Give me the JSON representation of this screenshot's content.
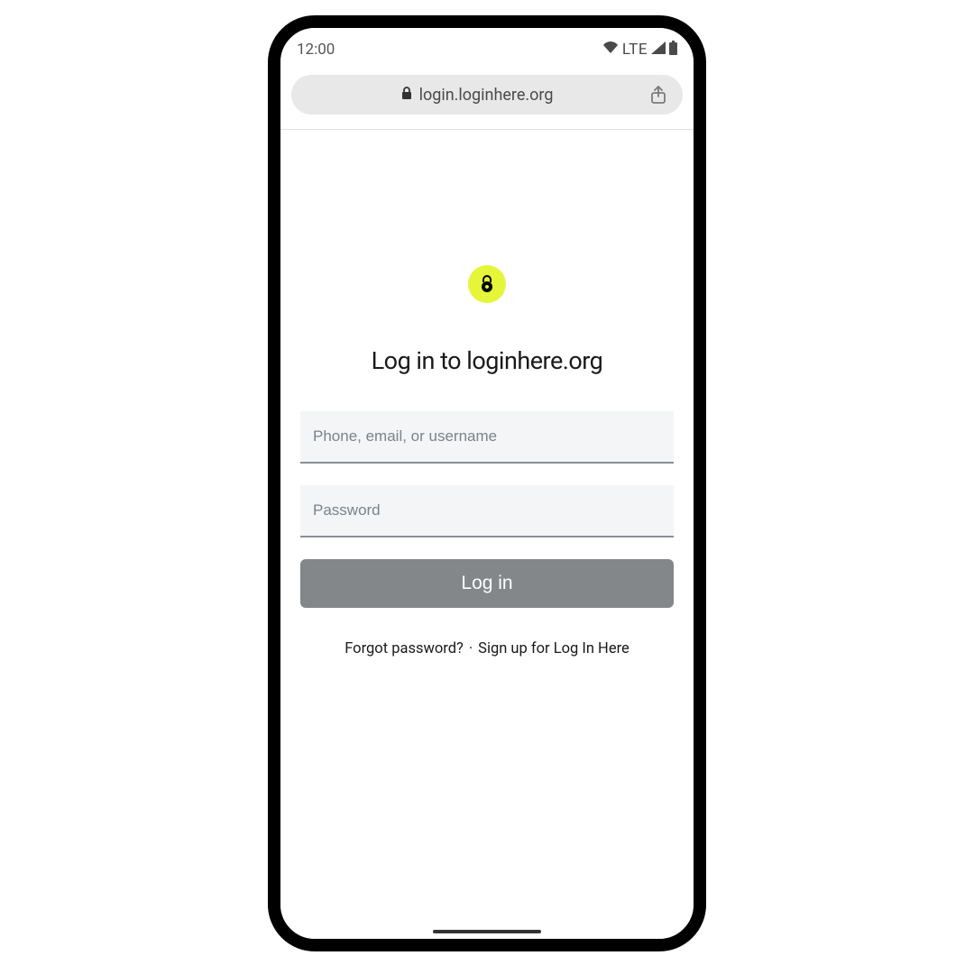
{
  "status_bar": {
    "time": "12:00",
    "network_type": "LTE"
  },
  "browser": {
    "url": "login.loginhere.org"
  },
  "login": {
    "title": "Log in to loginhere.org",
    "username_placeholder": "Phone, email, or username",
    "password_placeholder": "Password",
    "button_label": "Log in",
    "forgot_link": "Forgot password?",
    "signup_link": "Sign up for Log In Here",
    "link_separator": "·"
  },
  "colors": {
    "logo_bg": "#e5f53a",
    "input_bg": "#f3f5f7",
    "button_bg": "#83878a",
    "address_bg": "#e8e8e8"
  }
}
